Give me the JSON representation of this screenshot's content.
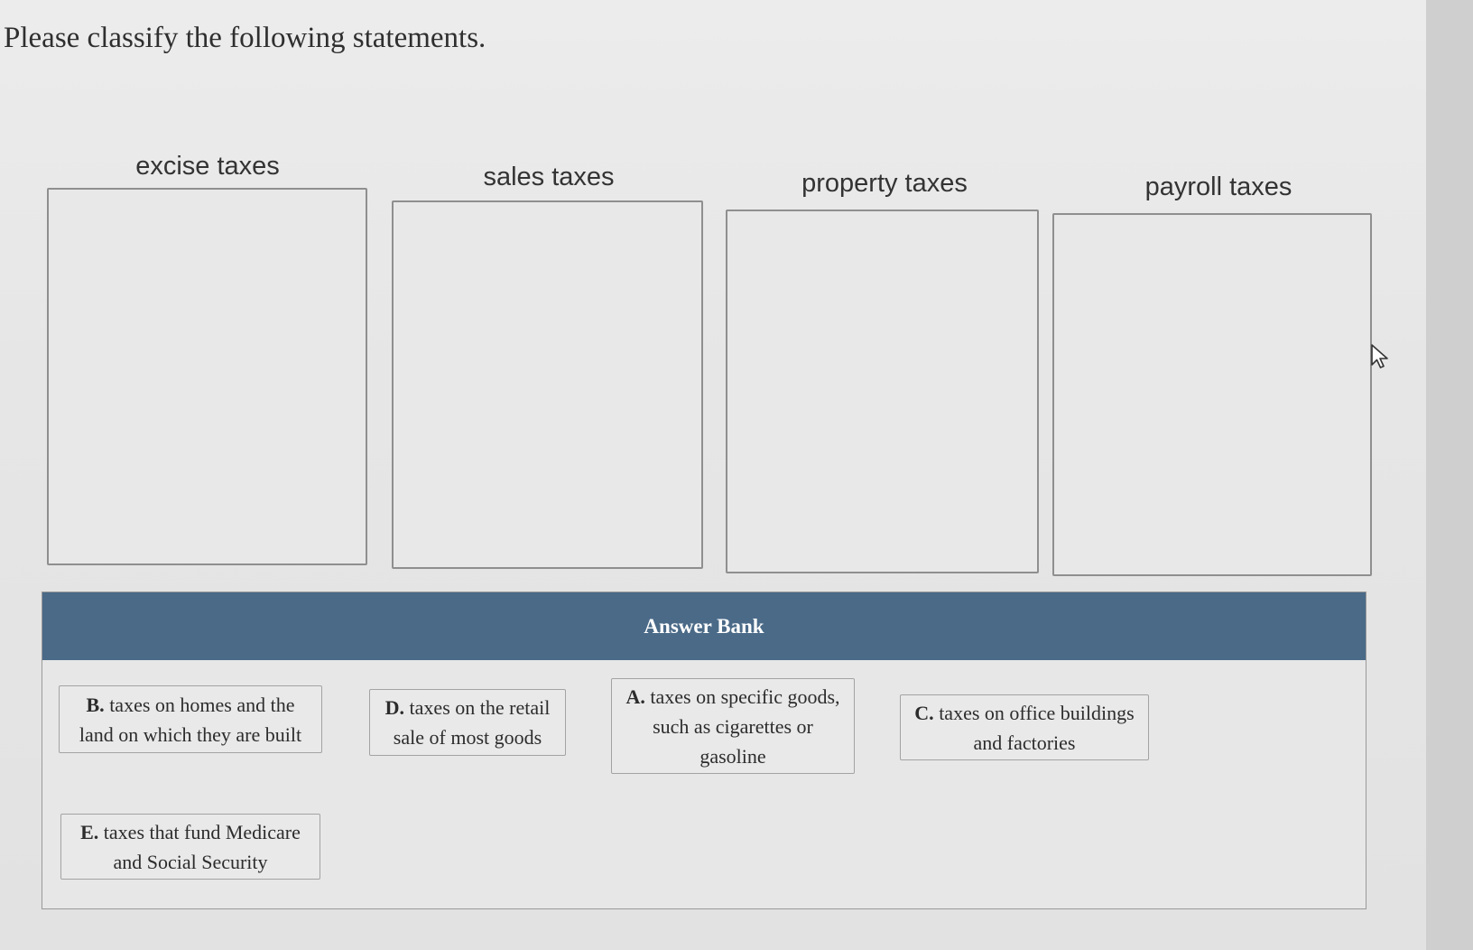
{
  "instructions": "Please classify the following statements.",
  "bins": [
    {
      "label": "excise taxes"
    },
    {
      "label": "sales taxes"
    },
    {
      "label": "property taxes"
    },
    {
      "label": "payroll taxes"
    }
  ],
  "answer_bank": {
    "title": "Answer Bank",
    "cards": [
      {
        "letter": "B.",
        "text": "taxes on homes and the land on which they are built"
      },
      {
        "letter": "D.",
        "text": "taxes on the retail sale of most goods"
      },
      {
        "letter": "A.",
        "text": "taxes on specific goods, such as cigarettes or gasoline"
      },
      {
        "letter": "C.",
        "text": "taxes on office buildings and factories"
      },
      {
        "letter": "E.",
        "text": "taxes that fund Medicare and Social Security"
      }
    ]
  },
  "icons": {
    "cursor": "pointer-arrow-icon"
  },
  "colors": {
    "answer_bank_header": "#4a6a88",
    "page_background": "#e6e6e6"
  }
}
